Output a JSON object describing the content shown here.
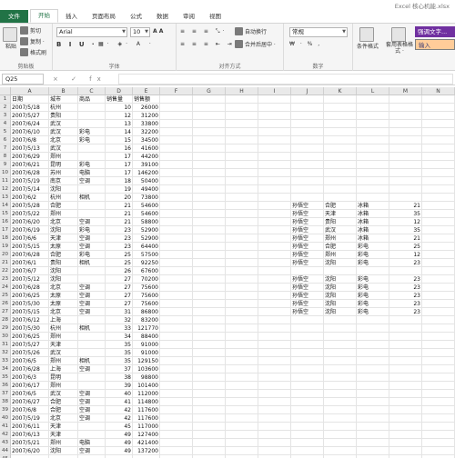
{
  "window": {
    "title": "Excel 核心机能.xlsx"
  },
  "ribbon_tabs": [
    "文件",
    "开始",
    "插入",
    "页面布局",
    "公式",
    "数据",
    "审阅",
    "视图"
  ],
  "ribbon": {
    "clipboard": {
      "paste": "粘贴",
      "cut": "剪切",
      "copy": "复制 ·",
      "format_painter": "格式刷",
      "label": "剪贴板"
    },
    "font": {
      "name": "Arial",
      "size": "10",
      "label": "字体"
    },
    "alignment": {
      "wrap": "自动换行",
      "merge": "合并后居中 ·",
      "label": "对齐方式"
    },
    "number": {
      "format": "常规",
      "currency": "₩ · % ,",
      "label": "数字"
    },
    "styles": {
      "conditional": "条件格式",
      "table": "套用表格格式 ·",
      "good": "强调文字...",
      "input": "输入"
    }
  },
  "formula_bar": {
    "name_box": "Q25",
    "buttons": "× ✓ fx"
  },
  "columns": [
    "A",
    "B",
    "C",
    "D",
    "E",
    "F",
    "G",
    "H",
    "I",
    "J",
    "K",
    "L",
    "M",
    "N",
    "O"
  ],
  "sheet": {
    "row_numbers": [
      "1",
      "2",
      "3",
      "4",
      "5",
      "6",
      "7",
      "8",
      "9",
      "10",
      "11",
      "12",
      "13",
      "14",
      "15",
      "16",
      "17",
      "18",
      "19",
      "20",
      "21",
      "22",
      "23",
      "24",
      "25",
      "26",
      "27",
      "28",
      "29",
      "30",
      "31",
      "32",
      "33",
      "34",
      "35",
      "36",
      "37",
      "38",
      "39",
      "40",
      "41",
      "42",
      "43",
      "44",
      "45"
    ],
    "rows": [
      [
        "日期",
        "城市",
        "商品",
        "销售量",
        "销售额"
      ],
      [
        "2007/5/18",
        "杭州",
        "",
        "10",
        "26000"
      ],
      [
        "2007/5/27",
        "贵阳",
        "",
        "12",
        "31200"
      ],
      [
        "2007/6/24",
        "武汉",
        "",
        "13",
        "33800"
      ],
      [
        "2007/6/10",
        "武汉",
        "彩电",
        "14",
        "32200"
      ],
      [
        "2007/6/8",
        "北京",
        "彩电",
        "15",
        "34500"
      ],
      [
        "2007/5/13",
        "武汉",
        "",
        "16",
        "41600"
      ],
      [
        "2007/6/29",
        "郑州",
        "",
        "17",
        "44200"
      ],
      [
        "2007/6/21",
        "昆明",
        "彩电",
        "17",
        "39100"
      ],
      [
        "2007/6/28",
        "苏州",
        "电脑",
        "17",
        "146200"
      ],
      [
        "2007/5/19",
        "南京",
        "空调",
        "18",
        "50400"
      ],
      [
        "2007/5/14",
        "沈阳",
        "",
        "19",
        "49400"
      ],
      [
        "2007/6/2",
        "杭州",
        "相机",
        "20",
        "73800"
      ],
      [
        "2007/5/28",
        "合肥",
        "",
        "21",
        "54600"
      ],
      [
        "2007/5/22",
        "郑州",
        "",
        "21",
        "54600"
      ],
      [
        "2007/6/20",
        "北京",
        "空调",
        "21",
        "58800"
      ],
      [
        "2007/6/19",
        "沈阳",
        "彩电",
        "23",
        "52900"
      ],
      [
        "2007/6/6",
        "天津",
        "空调",
        "23",
        "52900"
      ],
      [
        "2007/5/15",
        "太原",
        "空调",
        "23",
        "64400"
      ],
      [
        "2007/6/28",
        "合肥",
        "彩电",
        "25",
        "57500"
      ],
      [
        "2007/6/1",
        "贵阳",
        "相机",
        "25",
        "92250"
      ],
      [
        "2007/6/7",
        "沈阳",
        "",
        "26",
        "67600"
      ],
      [
        "2007/5/12",
        "沈阳",
        "",
        "27",
        "70200"
      ],
      [
        "2007/6/28",
        "北京",
        "空调",
        "27",
        "75600"
      ],
      [
        "2007/6/25",
        "太原",
        "空调",
        "27",
        "75600"
      ],
      [
        "2007/5/30",
        "太原",
        "空调",
        "27",
        "75600"
      ],
      [
        "2007/5/15",
        "北京",
        "空调",
        "31",
        "86800"
      ],
      [
        "2007/6/12",
        "上海",
        "",
        "32",
        "83200"
      ],
      [
        "2007/5/30",
        "杭州",
        "相机",
        "33",
        "121770"
      ],
      [
        "2007/6/25",
        "郑州",
        "",
        "34",
        "88400"
      ],
      [
        "2007/5/27",
        "天津",
        "",
        "35",
        "91000"
      ],
      [
        "2007/5/26",
        "武汉",
        "",
        "35",
        "91000"
      ],
      [
        "2007/6/5",
        "郑州",
        "相机",
        "35",
        "129150"
      ],
      [
        "2007/6/28",
        "上海",
        "空调",
        "37",
        "103600"
      ],
      [
        "2007/6/3",
        "昆明",
        "",
        "38",
        "98800"
      ],
      [
        "2007/6/17",
        "郑州",
        "",
        "39",
        "101400"
      ],
      [
        "2007/6/5",
        "武汉",
        "空调",
        "40",
        "112000"
      ],
      [
        "2007/6/27",
        "合肥",
        "空调",
        "41",
        "114800"
      ],
      [
        "2007/6/8",
        "合肥",
        "空调",
        "42",
        "117600"
      ],
      [
        "2007/5/19",
        "北京",
        "空调",
        "42",
        "117600"
      ],
      [
        "2007/6/11",
        "天津",
        "",
        "45",
        "117000"
      ],
      [
        "2007/6/13",
        "天津",
        "",
        "49",
        "127400"
      ],
      [
        "2007/5/21",
        "郑州",
        "电脑",
        "49",
        "421400"
      ],
      [
        "2007/6/20",
        "沈阳",
        "空调",
        "49",
        "137200"
      ]
    ],
    "side_table": [
      [
        "孙悟空",
        "合肥",
        "冰箱",
        "21"
      ],
      [
        "孙悟空",
        "天津",
        "冰箱",
        "35"
      ],
      [
        "孙悟空",
        "贵阳",
        "冰箱",
        "12"
      ],
      [
        "孙悟空",
        "武汉",
        "冰箱",
        "35"
      ],
      [
        "孙悟空",
        "郑州",
        "冰箱",
        "21"
      ],
      [
        "孙悟空",
        "合肥",
        "彩电",
        "25"
      ],
      [
        "孙悟空",
        "郑州",
        "彩电",
        "12"
      ],
      [
        "孙悟空",
        "沈阳",
        "彩电",
        "23"
      ],
      [
        "",
        "",
        "",
        ""
      ],
      [
        "孙悟空",
        "沈阳",
        "彩电",
        "23"
      ],
      [
        "孙悟空",
        "沈阳",
        "彩电",
        "23"
      ],
      [
        "孙悟空",
        "沈阳",
        "彩电",
        "23"
      ],
      [
        "孙悟空",
        "沈阳",
        "彩电",
        "23"
      ],
      [
        "孙悟空",
        "沈阳",
        "彩电",
        "23"
      ]
    ]
  }
}
